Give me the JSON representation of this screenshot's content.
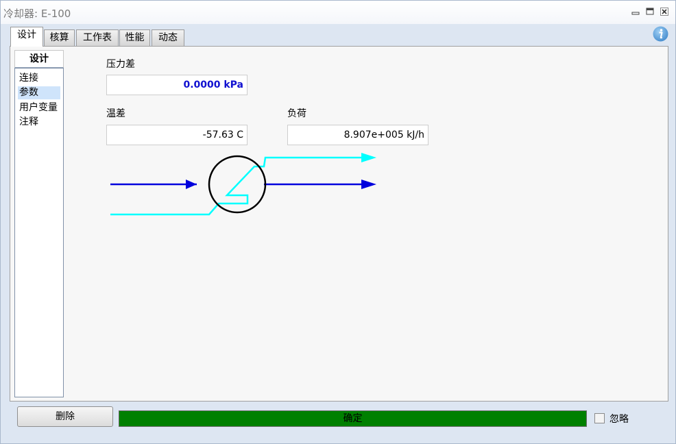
{
  "window": {
    "title": "冷却器: E-100",
    "controls": [
      "minimize-icon",
      "restore-icon",
      "close-icon"
    ]
  },
  "tabs": [
    {
      "label": "设计",
      "active": true
    },
    {
      "label": "核算",
      "active": false
    },
    {
      "label": "工作表",
      "active": false
    },
    {
      "label": "性能",
      "active": false
    },
    {
      "label": "动态",
      "active": false
    }
  ],
  "info_icon": "info-icon",
  "sidebar": {
    "header": "设计",
    "items": [
      {
        "label": "连接",
        "selected": false
      },
      {
        "label": "参数",
        "selected": true
      },
      {
        "label": "用户变量",
        "selected": false
      },
      {
        "label": "注释",
        "selected": false
      }
    ]
  },
  "form": {
    "pressure_drop": {
      "label": "压力差",
      "value": "0.0000 kPa"
    },
    "temp_difference": {
      "label": "温差",
      "value": "-57.63 C"
    },
    "duty": {
      "label": "负荷",
      "value": "8.907e+005 kJ/h"
    }
  },
  "diagram": {
    "process_stream_color": "#0000dd",
    "utility_stream_color": "#00ffff",
    "exchanger_outline_color": "#000000"
  },
  "footer": {
    "delete_label": "删除",
    "status_text": "确定",
    "status_color": "#008000",
    "ignore_label": "忽略",
    "ignore_checked": false
  }
}
